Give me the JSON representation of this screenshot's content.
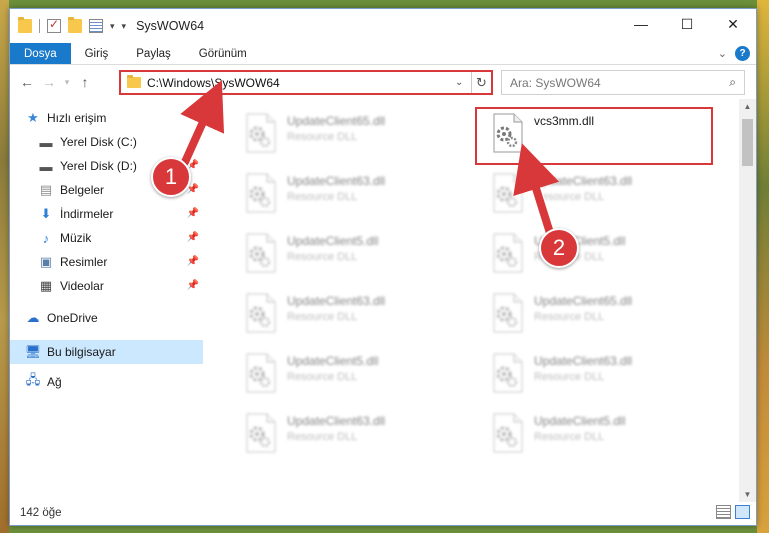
{
  "window": {
    "title": "SysWOW64"
  },
  "window_controls": {
    "minimize": "—",
    "maximize": "☐",
    "close": "✕"
  },
  "ribbon": {
    "tabs": [
      "Dosya",
      "Giriş",
      "Paylaş",
      "Görünüm"
    ]
  },
  "address": {
    "path": "C:\\Windows\\SysWOW64"
  },
  "search": {
    "placeholder": "Ara: SysWOW64"
  },
  "nav": {
    "quick_access": "Hızlı erişim",
    "items": [
      "Yerel Disk (C:)",
      "Yerel Disk (D:)",
      "Belgeler",
      "İndirmeler",
      "Müzik",
      "Resimler",
      "Videolar"
    ],
    "onedrive": "OneDrive",
    "this_pc": "Bu bilgisayar",
    "network": "Ağ"
  },
  "files": [
    {
      "name": "UpdateClient65.dll",
      "type": "Resource DLL"
    },
    {
      "name": "vcs3mm.dll",
      "type": ""
    },
    {
      "name": "UpdateClient63.dll",
      "type": "Resource DLL"
    },
    {
      "name": "UpdateClient63.dll",
      "type": "Resource DLL"
    },
    {
      "name": "UpdateClient5.dll",
      "type": "Resource DLL"
    },
    {
      "name": "UpdateClient5.dll",
      "type": "Resource DLL"
    },
    {
      "name": "UpdateClient63.dll",
      "type": "Resource DLL"
    },
    {
      "name": "UpdateClient65.dll",
      "type": "Resource DLL"
    },
    {
      "name": "UpdateClient5.dll",
      "type": "Resource DLL"
    },
    {
      "name": "UpdateClient63.dll",
      "type": "Resource DLL"
    },
    {
      "name": "UpdateClient63.dll",
      "type": "Resource DLL"
    },
    {
      "name": "UpdateClient5.dll",
      "type": "Resource DLL"
    }
  ],
  "status": {
    "count": "142 öğe"
  },
  "callouts": [
    "1",
    "2"
  ],
  "colors": {
    "accent": "#1979ca",
    "highlight": "#d9383a",
    "selected": "#cce8ff"
  }
}
